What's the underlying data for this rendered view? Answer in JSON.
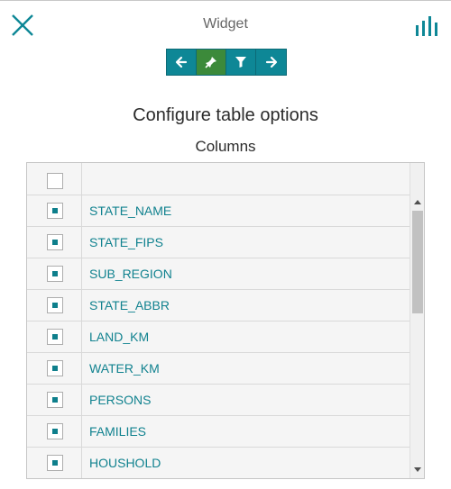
{
  "header": {
    "title": "Widget",
    "close_icon": "close-icon",
    "chart_icon": "bar-chart-icon"
  },
  "toolbar": {
    "buttons": [
      {
        "icon": "arrow-left-icon",
        "active": false
      },
      {
        "icon": "pin-icon",
        "active": true
      },
      {
        "icon": "filter-icon",
        "active": false
      },
      {
        "icon": "arrow-right-icon",
        "active": false
      }
    ]
  },
  "main": {
    "heading": "Configure table options",
    "subheading": "Columns"
  },
  "columns": {
    "header_label": "",
    "header_checked": false,
    "rows": [
      {
        "label": "STATE_NAME",
        "checked": true
      },
      {
        "label": "STATE_FIPS",
        "checked": true
      },
      {
        "label": "SUB_REGION",
        "checked": true
      },
      {
        "label": "STATE_ABBR",
        "checked": true
      },
      {
        "label": "LAND_KM",
        "checked": true
      },
      {
        "label": "WATER_KM",
        "checked": true
      },
      {
        "label": "PERSONS",
        "checked": true
      },
      {
        "label": "FAMILIES",
        "checked": true
      },
      {
        "label": "HOUSHOLD",
        "checked": true
      }
    ]
  },
  "colors": {
    "accent": "#0e8796",
    "active": "#3c8a3a",
    "link_text": "#11828f"
  }
}
